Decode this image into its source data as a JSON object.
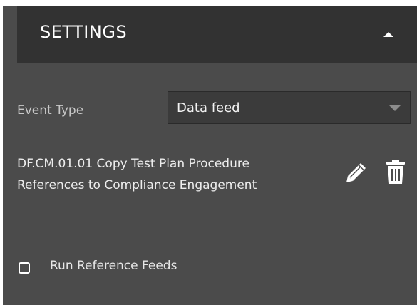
{
  "settings": {
    "title": "SETTINGS",
    "collapse_icon": "caret-up-icon"
  },
  "event_type": {
    "label": "Event Type",
    "selected_value": "Data feed",
    "arrow_icon": "caret-down-icon"
  },
  "data_feed": {
    "title": "DF.CM.01.01 Copy Test Plan Procedure References to Compliance Engagement",
    "edit_icon": "pencil-icon",
    "delete_icon": "trash-icon"
  },
  "run_reference_feeds": {
    "label": "Run Reference Feeds",
    "checked": false
  },
  "colors": {
    "panel_background": "#4b4b4b",
    "header_background": "#323232",
    "text_primary": "#ffffff",
    "text_secondary": "#c8c8c8"
  }
}
